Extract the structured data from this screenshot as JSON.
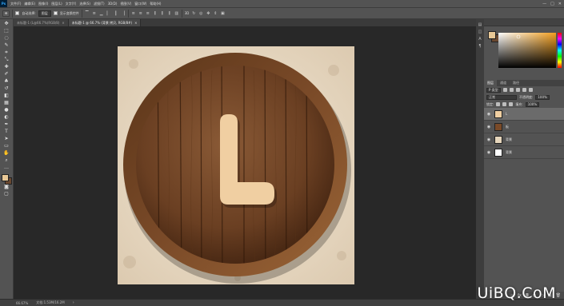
{
  "menubar": {
    "logo": "Ps",
    "items": [
      "文件(F)",
      "编辑(E)",
      "图像(I)",
      "图层(L)",
      "文字(Y)",
      "选择(S)",
      "滤镜(T)",
      "3D(D)",
      "视图(V)",
      "窗口(W)",
      "帮助(H)"
    ],
    "window_controls": [
      "—",
      "□",
      "✕"
    ]
  },
  "options_bar": {
    "auto_select_label": "自动选择:",
    "auto_select_value": "图层",
    "show_transform_label": "显示变换控件"
  },
  "tabs": [
    {
      "label": "未标题-1 (L@66.7%(RGB/8)",
      "close": "×"
    },
    {
      "label": "未标题-1 @ 66.7% (背景 拷贝, RGB/8#)",
      "close": "×"
    }
  ],
  "colors": {
    "foreground": "#e8c896",
    "background": "#6a4830"
  },
  "layers_panel": {
    "tabs": [
      "图层",
      "通道",
      "路径"
    ],
    "kind_label": "P 类型",
    "blend_mode": "正常",
    "opacity_label": "不透明度:",
    "opacity_value": "100%",
    "lock_label": "锁定:",
    "fill_label": "填充:",
    "fill_value": "100%",
    "layers": [
      {
        "name": "L",
        "selected": true
      },
      {
        "name": "板",
        "selected": false
      },
      {
        "name": "背景",
        "selected": false
      },
      {
        "name": "背景",
        "selected": false
      }
    ]
  },
  "status": {
    "zoom": "66.67%",
    "doc_info": "文档:1.53M/16.2M"
  },
  "watermark": "UiBQ.CoM"
}
